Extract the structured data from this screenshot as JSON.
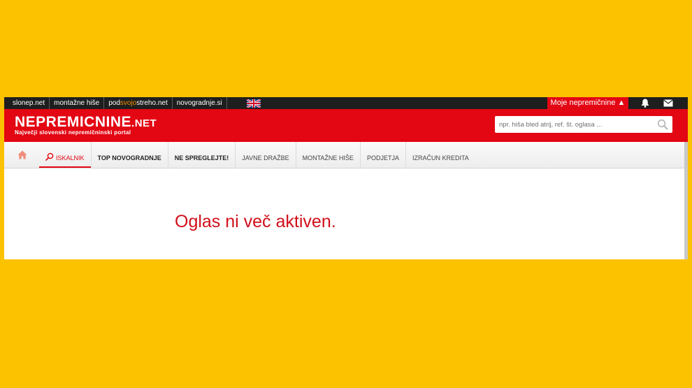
{
  "top_links": [
    "slonep.net",
    "montažne hiše",
    "novogradnje.si"
  ],
  "podsvojostreho": {
    "pre": "pod",
    "mid": "svojo",
    "post": "streho.net"
  },
  "my_account_label": "Moje nepremičnine ▲",
  "logo": {
    "main": "NEPREMICNINE",
    "suffix": ".NET"
  },
  "tagline": "Največji slovenski nepremičninski portal",
  "search": {
    "placeholder": "npr. hiša bled atrij, ref. št. oglasa ..."
  },
  "nav": {
    "iskalnik": "ISKALNIK",
    "top_novogradnje": "TOP NOVOGRADNJE",
    "ne_spreglejte": "NE SPREGLEJTE!",
    "javne_drazbe": "JAVNE DRAŽBE",
    "montazne_hise": "MONTAŽNE HIŠE",
    "podjetja": "PODJETJA",
    "izracun_kredita": "IZRAČUN KREDITA"
  },
  "message": "Oglas ni več aktiven.",
  "colors": {
    "brand_red": "#e30613",
    "background": "#fcc200",
    "accent_orange": "#f39200"
  },
  "icons": [
    "uk-flag-icon",
    "bell-icon",
    "mail-icon",
    "search-icon",
    "home-icon"
  ]
}
